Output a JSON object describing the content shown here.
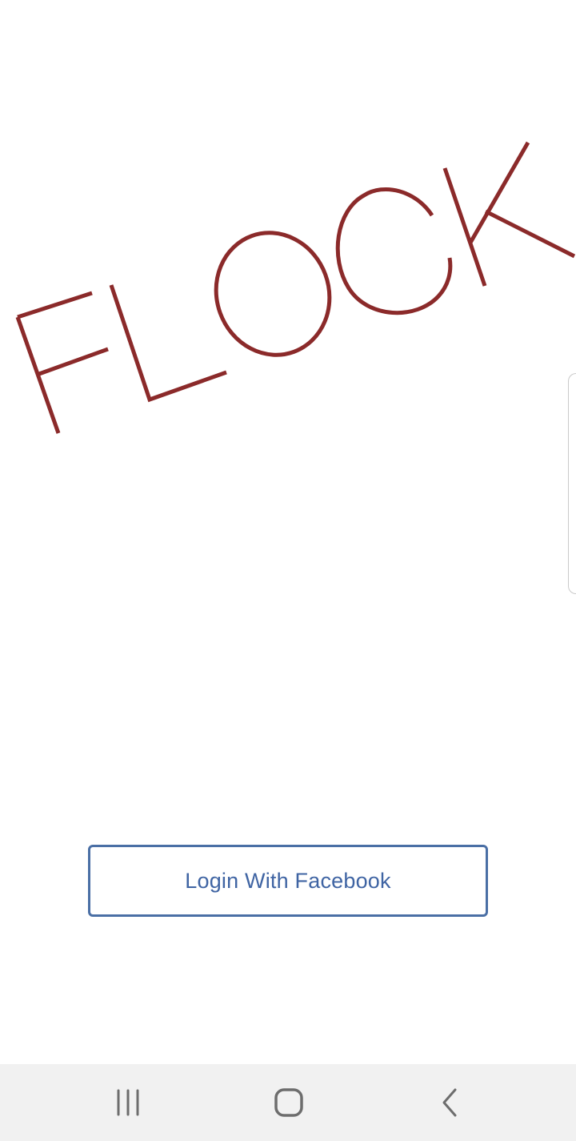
{
  "app": {
    "logo_text": "FLOCK",
    "brand_color": "#8b2a2a"
  },
  "login": {
    "button_label": "Login With Facebook",
    "accent_color": "#4a6fa5"
  },
  "nav_bar": {
    "buttons": [
      {
        "icon": "recent-apps-icon"
      },
      {
        "icon": "home-icon"
      },
      {
        "icon": "back-icon"
      }
    ]
  }
}
